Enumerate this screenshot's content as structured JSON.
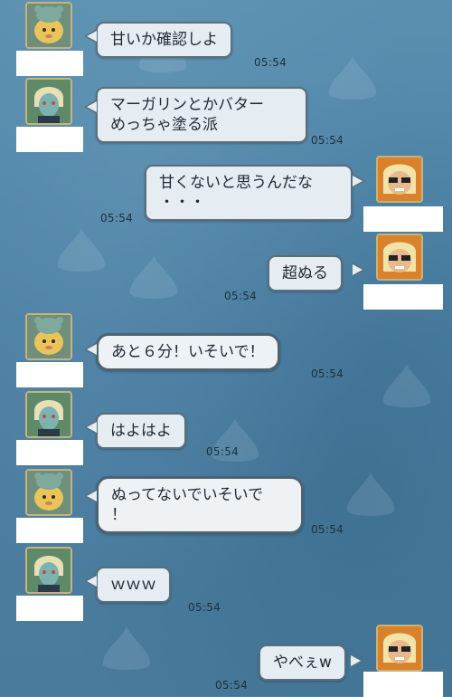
{
  "messages": [
    {
      "side": "left",
      "sender": "bear",
      "text": "甘いか確認しよ",
      "time": "05:54"
    },
    {
      "side": "left",
      "sender": "elf",
      "text": "マーガリンとかバター\nめっちゃ塗る派",
      "time": "05:54"
    },
    {
      "side": "right",
      "sender": "blonde",
      "text": "甘くないと思うんだな\n・・・",
      "time": "05:54"
    },
    {
      "side": "right",
      "sender": "blonde",
      "text": "超ぬる",
      "time": "05:54"
    },
    {
      "side": "left",
      "sender": "bear",
      "text": "あと６分！いそいで！",
      "time": "05:54"
    },
    {
      "side": "left",
      "sender": "elf",
      "text": "はよはよ",
      "time": "05:54"
    },
    {
      "side": "left",
      "sender": "bear",
      "text": "ぬってないでいそいで\n！",
      "time": "05:54"
    },
    {
      "side": "left",
      "sender": "elf",
      "text": "ｗｗｗ",
      "time": "05:54"
    },
    {
      "side": "right",
      "sender": "blonde",
      "text": "やべぇw",
      "time": "05:54"
    }
  ],
  "colors": {
    "background": "#4a7ea0",
    "bubble": "#e5edf2",
    "bubble_border": "#5b6f7c"
  }
}
